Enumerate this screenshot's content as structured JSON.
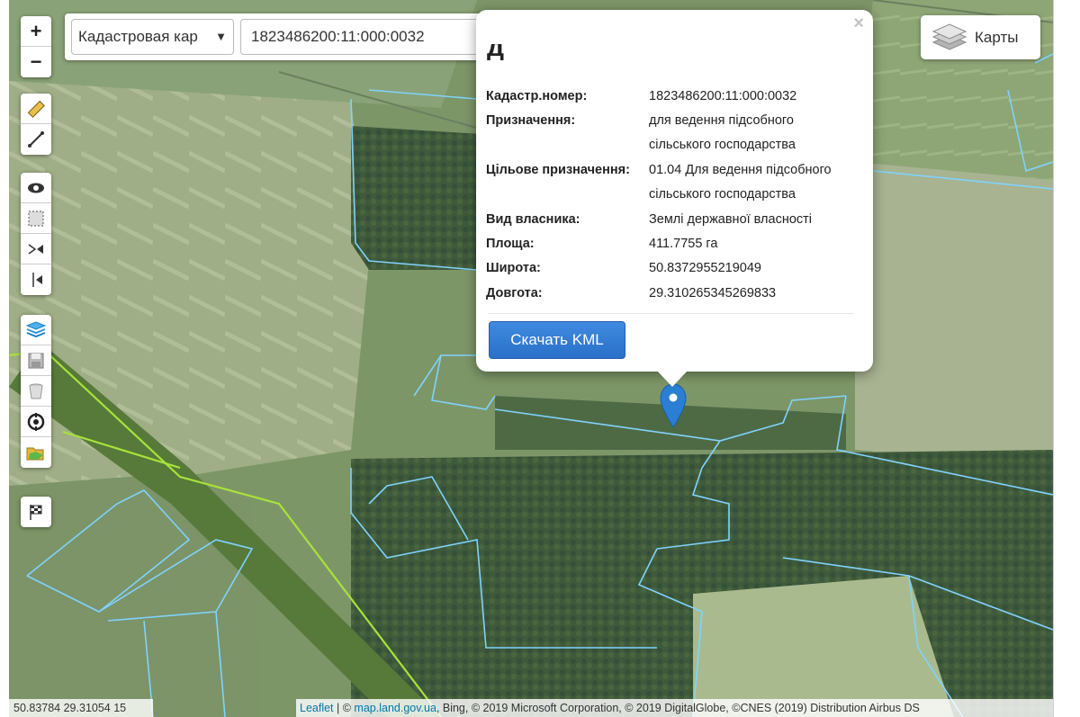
{
  "search": {
    "layer_select": "Кадастровая кар",
    "query_value": "1823486200:11:000:0032"
  },
  "zoom": {
    "in_label": "+",
    "out_label": "−"
  },
  "toolbar_icons": [
    "ruler-icon",
    "line-measure-icon",
    "eye-icon",
    "select-area-icon",
    "split-icon",
    "cut-icon",
    "layers-stack-icon",
    "save-icon",
    "trash-icon",
    "target-icon",
    "folder-map-icon",
    "checkered-flag-icon"
  ],
  "layers_button": {
    "label": "Карты"
  },
  "popup": {
    "close": "×",
    "rows": [
      {
        "key": "Кадастр.номер:",
        "value": "1823486200:11:000:0032"
      },
      {
        "key": "Призначення:",
        "value": "для ведення підсобного",
        "value2": "сільського господарства"
      },
      {
        "key": "Цільове призначення:",
        "value": "01.04 Для ведення підсобного",
        "value2": "сільського господарства"
      },
      {
        "key": "Вид власника:",
        "value": "Землі державної власності"
      },
      {
        "key": "Площа:",
        "value": "411.7755 га"
      },
      {
        "key": "Широта:",
        "value": "50.8372955219049"
      },
      {
        "key": "Довгота:",
        "value": "29.310265345269833"
      }
    ],
    "download_button": "Скачать KML"
  },
  "status": {
    "coordinates": "50.83784 29.31054 15"
  },
  "attribution": {
    "leaflet": "Leaflet",
    "sep": " | © ",
    "site": "map.land.gov.ua",
    "rest": ", Bing, © 2019 Microsoft Corporation, © 2019 DigitalGlobe, ©CNES (2019) Distribution Airbus DS"
  },
  "colors": {
    "parcel_border": "#7fd3ff",
    "boundary": "#a8e23a",
    "marker": "#2a7fd4",
    "button": "#3080d8"
  }
}
